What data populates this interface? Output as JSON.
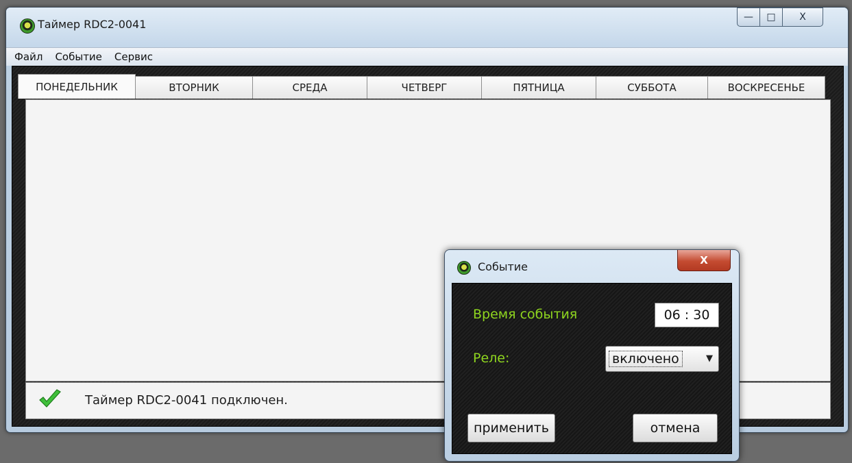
{
  "window": {
    "title": "Таймер RDC2-0041",
    "controls": {
      "minimize": "—",
      "maximize": "□",
      "close": "X"
    }
  },
  "menu": {
    "items": [
      "Файл",
      "Событие",
      "Сервис"
    ]
  },
  "tabs": [
    {
      "label": "ПОНЕДЕЛЬНИК",
      "active": true
    },
    {
      "label": "ВТОРНИК",
      "active": false
    },
    {
      "label": "СРЕДА",
      "active": false
    },
    {
      "label": "ЧЕТВЕРГ",
      "active": false
    },
    {
      "label": "ПЯТНИЦА",
      "active": false
    },
    {
      "label": "СУББОТА",
      "active": false
    },
    {
      "label": "ВОСКРЕСЕНЬЕ",
      "active": false
    }
  ],
  "status": {
    "icon": "check-icon",
    "text": "Таймер RDC2-0041 подключен."
  },
  "dialog": {
    "title": "Событие",
    "close": "X",
    "time_label": "Время события",
    "time_value": "06 : 30",
    "relay_label": "Реле:",
    "relay_value": "включено",
    "apply_label": "применить",
    "cancel_label": "отмена",
    "label_color": "#8fd61f"
  }
}
